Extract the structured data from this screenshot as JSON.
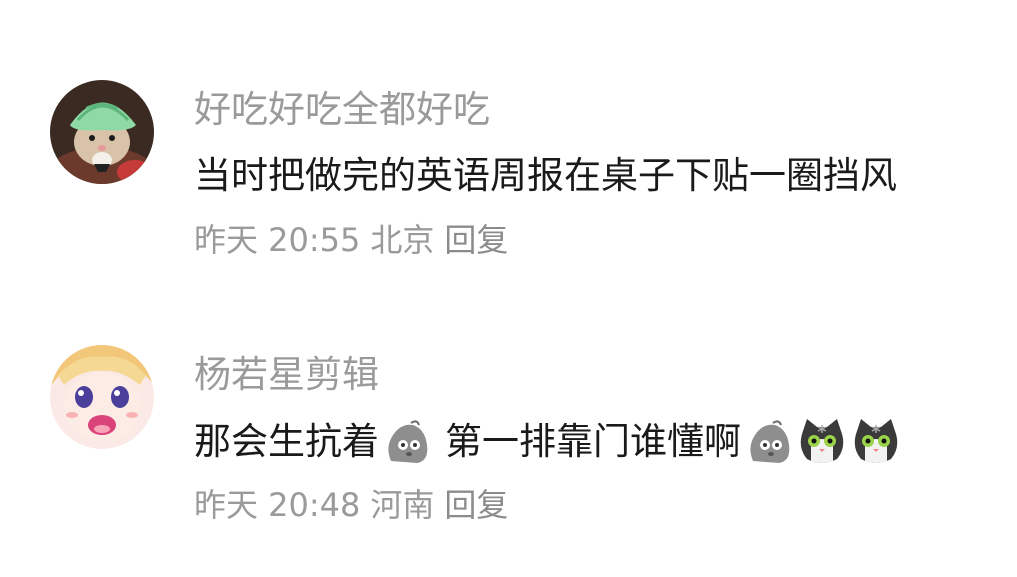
{
  "comments": [
    {
      "username": "好吃好吃全都好吃",
      "text_parts": [
        "当时把做完的英语周报在桌子下贴一圈挡风"
      ],
      "time": "昨天 20:55",
      "location": "北京",
      "reply_label": "回复",
      "avatar_icon": "hamster-melon-hat-avatar"
    },
    {
      "username": "杨若星剪辑",
      "text_parts": [
        "那会生抗着",
        "第一排靠门谁懂啊"
      ],
      "time": "昨天 20:48",
      "location": "河南",
      "reply_label": "回复",
      "avatar_icon": "anime-girl-avatar",
      "emojis": [
        "rock-face-emoji",
        "rock-face-emoji",
        "cat-face-emoji",
        "cat-face-emoji"
      ]
    }
  ],
  "colors": {
    "username": "#9a9a9a",
    "content": "#1a1a1a",
    "meta": "#9a9a9a"
  }
}
